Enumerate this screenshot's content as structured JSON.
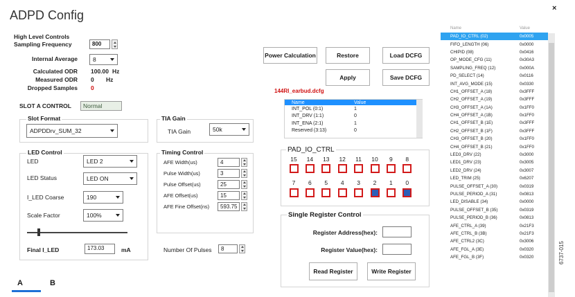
{
  "window": {
    "title": "ADPD Config",
    "close_glyph": "×",
    "figure_code": "6737-015"
  },
  "high_level": {
    "title": "High Level Controls",
    "sampling_frequency": {
      "label": "Sampling Frequency",
      "value": "800"
    },
    "internal_average": {
      "label": "Internal Average",
      "value": "8"
    },
    "calculated_odr": {
      "label": "Calculated ODR",
      "value": "100.00",
      "unit": "Hz"
    },
    "measured_odr": {
      "label": "Measured ODR",
      "value": "0",
      "unit": "Hz"
    },
    "dropped_samples": {
      "label": "Dropped Samples",
      "value": "0"
    }
  },
  "slot_control": {
    "title": "SLOT A CONTROL",
    "status": "Normal",
    "slot_format": {
      "title": "Slot Format",
      "value": "ADPDDrv_SUM_32"
    },
    "tia_gain": {
      "title": "TIA Gain",
      "label": "TIA Gain",
      "value": "50k"
    },
    "led_control": {
      "title": "LED Control",
      "led": {
        "label": "LED",
        "value": "LED 2"
      },
      "led_status": {
        "label": "LED Status",
        "value": "LED ON"
      },
      "iled_coarse": {
        "label": "I_LED Coarse",
        "value": "190"
      },
      "scale_factor": {
        "label": "Scale Factor",
        "value": "100%"
      },
      "final_iled": {
        "label": "Final I_LED",
        "value": "173.03",
        "unit": "mA"
      }
    },
    "timing_control": {
      "title": "Timing Control",
      "items": [
        {
          "label": "AFE Width(us)",
          "value": "4"
        },
        {
          "label": "Pulse Width(us)",
          "value": "3"
        },
        {
          "label": "Pulse Offset(us)",
          "value": "25"
        },
        {
          "label": "AFE Offset(us)",
          "value": "15"
        },
        {
          "label": "AFE Fine Offset(ns)",
          "value": "593.75"
        }
      ]
    },
    "num_pulses": {
      "label": "Number Of Pulses",
      "value": "8"
    }
  },
  "buttons": {
    "power_calculation": "Power Calculation",
    "restore": "Restore",
    "load_dcfg": "Load DCFG",
    "apply": "Apply",
    "save_dcfg": "Save DCFG"
  },
  "dcfg_file": "144RI_earbud.dcfg",
  "bitfield_table": {
    "headers": [
      "Name",
      "Value"
    ],
    "rows": [
      {
        "name": "INT_POL (0:1)",
        "value": "1"
      },
      {
        "name": "INT_DRV (1:1)",
        "value": "0"
      },
      {
        "name": "INT_ENA (2:1)",
        "value": "1"
      },
      {
        "name": "Reserved (3:13)",
        "value": "0"
      }
    ]
  },
  "pad_io": {
    "title": "PAD_IO_CTRL",
    "upper_bits": [
      "15",
      "14",
      "13",
      "12",
      "11",
      "10",
      "9",
      "8"
    ],
    "upper_states": [
      0,
      0,
      0,
      0,
      0,
      0,
      0,
      0
    ],
    "lower_bits": [
      "7",
      "6",
      "5",
      "4",
      "3",
      "2",
      "1",
      "0"
    ],
    "lower_states": [
      0,
      0,
      0,
      0,
      0,
      1,
      0,
      1
    ]
  },
  "single_register": {
    "title": "Single Register Control",
    "address_label": "Register Address(hex):",
    "address_value": "",
    "value_label": "Register Value(hex):",
    "value_value": "",
    "read_button": "Read Register",
    "write_button": "Write Register"
  },
  "register_list": {
    "headers": [
      "Name",
      "Value"
    ],
    "selected_index": 0,
    "rows": [
      {
        "name": "PAD_IO_CTRL (02)",
        "value": "0x0005"
      },
      {
        "name": "FIFO_LENGTH (06)",
        "value": "0x0000"
      },
      {
        "name": "CHIPID (08)",
        "value": "0x0416"
      },
      {
        "name": "OP_MODE_CFG (11)",
        "value": "0x30A3"
      },
      {
        "name": "SAMPLING_FREQ (12)",
        "value": "0x000A"
      },
      {
        "name": "PD_SELECT (14)",
        "value": "0x0116"
      },
      {
        "name": "INT_AVG_MODE (15)",
        "value": "0x0330"
      },
      {
        "name": "CH1_OFFSET_A (18)",
        "value": "0x3FFF"
      },
      {
        "name": "CH2_OFFSET_A (19)",
        "value": "0x3FFF"
      },
      {
        "name": "CH3_OFFSET_A (1A)",
        "value": "0x1FF0"
      },
      {
        "name": "CH4_OFFSET_A (1B)",
        "value": "0x1FF0"
      },
      {
        "name": "CH1_OFFSET_B (1E)",
        "value": "0x3FFF"
      },
      {
        "name": "CH2_OFFSET_B (1F)",
        "value": "0x3FFF"
      },
      {
        "name": "CH3_OFFSET_B (20)",
        "value": "0x1FF0"
      },
      {
        "name": "CH4_OFFSET_B (21)",
        "value": "0x1FF0"
      },
      {
        "name": "LED3_DRV (22)",
        "value": "0x3000"
      },
      {
        "name": "LED1_DRV (23)",
        "value": "0x3005"
      },
      {
        "name": "LED2_DRV (24)",
        "value": "0x3007"
      },
      {
        "name": "LED_TRIM (25)",
        "value": "0x6207"
      },
      {
        "name": "PULSE_OFFSET_A (30)",
        "value": "0x0319"
      },
      {
        "name": "PULSE_PERIOD_A (31)",
        "value": "0x0813"
      },
      {
        "name": "LED_DISABLE (34)",
        "value": "0x0000"
      },
      {
        "name": "PULSE_OFFSET_B (35)",
        "value": "0x0319"
      },
      {
        "name": "PULSE_PERIOD_B (36)",
        "value": "0x0813"
      },
      {
        "name": "AFE_CTRL_A (39)",
        "value": "0x21F3"
      },
      {
        "name": "AFE_CTRL_B (3B)",
        "value": "0x21F3"
      },
      {
        "name": "AFE_CTRL2 (3C)",
        "value": "0x3006"
      },
      {
        "name": "AFE_FGL_A (3E)",
        "value": "0x0320"
      },
      {
        "name": "AFE_FGL_B (3F)",
        "value": "0x0320"
      }
    ]
  },
  "tabs": [
    {
      "label": "A",
      "active": true
    },
    {
      "label": "B",
      "active": false
    }
  ],
  "slider": {
    "level_fraction": 0.12
  }
}
